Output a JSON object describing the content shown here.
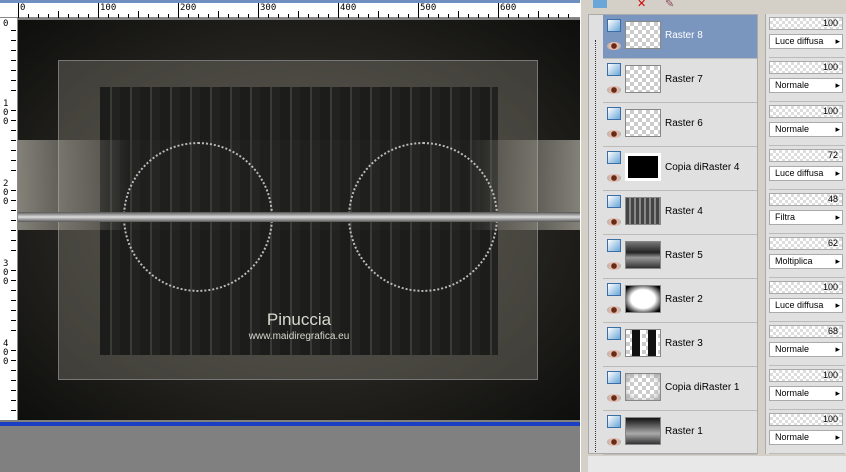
{
  "rulers": {
    "top": [
      "0",
      "100",
      "200",
      "300",
      "400",
      "500",
      "600"
    ],
    "left": [
      "0",
      "1 0 0",
      "2 0 0",
      "3 0 0",
      "4 0 0"
    ]
  },
  "canvas": {
    "watermark_title": "Pinuccia",
    "watermark_url": "www.maidiregrafica.eu"
  },
  "layers": [
    {
      "name": "Raster 8",
      "opacity": "100",
      "blend": "Luce diffusa",
      "selected": true
    },
    {
      "name": "Raster 7",
      "opacity": "100",
      "blend": "Normale"
    },
    {
      "name": "Raster 6",
      "opacity": "100",
      "blend": "Normale"
    },
    {
      "name": "Copia diRaster 4",
      "opacity": "72",
      "blend": "Luce diffusa"
    },
    {
      "name": "Raster 4",
      "opacity": "48",
      "blend": "Filtra"
    },
    {
      "name": "Raster 5",
      "opacity": "62",
      "blend": "Moltiplica"
    },
    {
      "name": "Raster 2",
      "opacity": "100",
      "blend": "Luce diffusa"
    },
    {
      "name": "Raster 3",
      "opacity": "68",
      "blend": "Normale"
    },
    {
      "name": "Copia diRaster 1",
      "opacity": "100",
      "blend": "Normale"
    },
    {
      "name": "Raster 1",
      "opacity": "100",
      "blend": "Normale"
    }
  ],
  "colors": {
    "selection": "#7a96be",
    "canvas_border": "#1a3fc0"
  }
}
